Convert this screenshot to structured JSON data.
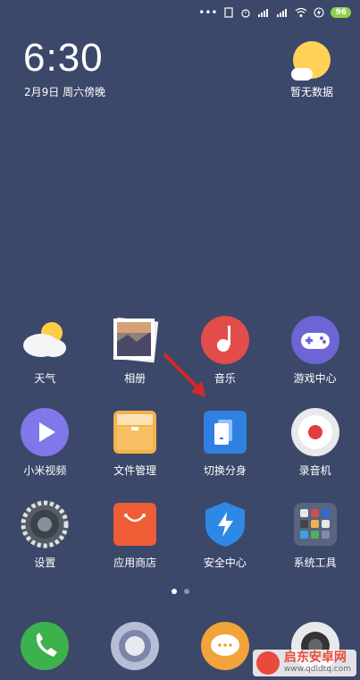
{
  "status_bar": {
    "dots": "•••",
    "battery": "96"
  },
  "clock": {
    "time": "6:30",
    "date": "2月9日 周六傍晚"
  },
  "weather": {
    "text": "暂无数据"
  },
  "apps": [
    {
      "label": "天气",
      "icon": "weather-icon"
    },
    {
      "label": "相册",
      "icon": "gallery-icon"
    },
    {
      "label": "音乐",
      "icon": "music-icon"
    },
    {
      "label": "游戏中心",
      "icon": "game-center-icon"
    },
    {
      "label": "小米视频",
      "icon": "video-icon"
    },
    {
      "label": "文件管理",
      "icon": "file-manager-icon"
    },
    {
      "label": "切换分身",
      "icon": "switch-profile-icon"
    },
    {
      "label": "录音机",
      "icon": "recorder-icon"
    },
    {
      "label": "设置",
      "icon": "settings-icon"
    },
    {
      "label": "应用商店",
      "icon": "app-store-icon"
    },
    {
      "label": "安全中心",
      "icon": "security-center-icon"
    },
    {
      "label": "系统工具",
      "icon": "system-tools-icon"
    }
  ],
  "page_indicator": {
    "pages": 2,
    "current": 1
  },
  "dock": [
    {
      "icon": "phone-icon"
    },
    {
      "icon": "browser-icon"
    },
    {
      "icon": "messages-icon"
    },
    {
      "icon": "camera-icon"
    }
  ],
  "watermark": {
    "title": "启东安卓网",
    "url": "www.qdldtq.com"
  }
}
